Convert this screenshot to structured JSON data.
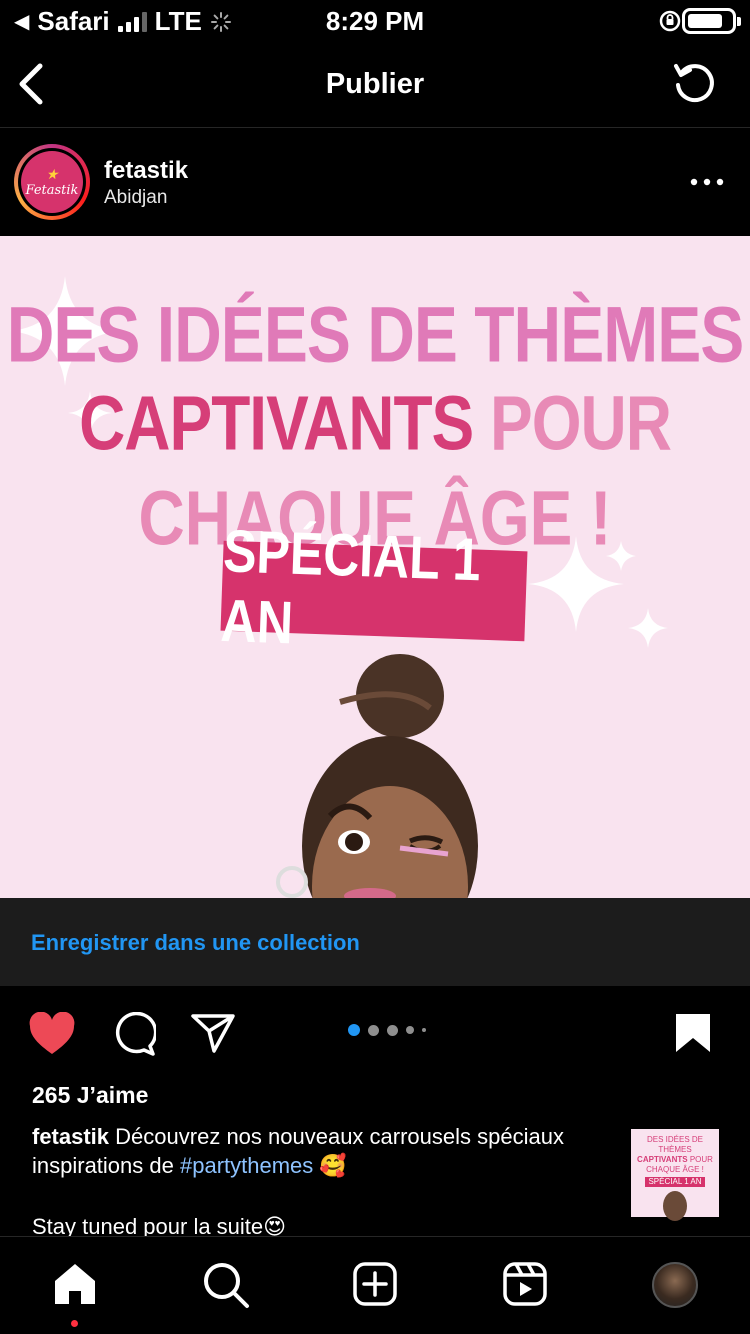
{
  "status_bar": {
    "back_app": "Safari",
    "carrier": "LTE",
    "time": "8:29 PM"
  },
  "nav": {
    "title": "Publier"
  },
  "post": {
    "username": "fetastik",
    "location": "Abidjan",
    "logo_text": "Fetastik",
    "image": {
      "line1": "DES IDÉES DE THÈMES",
      "line2a": "CAPTIVANTS",
      "line2b": "POUR",
      "line3": "CHAQUE ÂGE !",
      "badge": "SPÉCIAL 1 AN"
    },
    "save_to_collection": "Enregistrer dans une collection",
    "carousel": {
      "count": 5,
      "active_index": 0
    },
    "likes": "265 J’aime",
    "caption_user": "fetastik",
    "caption_text": "Découvrez nos nouveaux carrousels spéciaux",
    "caption_line2": "inspirations de",
    "hashtag": "#partythemes",
    "caption_emoji1": "🥰",
    "caption_line3": "Stay tuned pour la suite",
    "caption_emoji2": "😍",
    "thumbnail": {
      "line1": "DES IDÉES DE THÈMES",
      "line2a": "CAPTIVANTS",
      "line2b": "POUR",
      "line3": "CHAQUE ÂGE !",
      "badge": "SPÉCIAL 1 AN"
    }
  },
  "colors": {
    "accent_blue": "#2196f3",
    "like_red": "#ed4956",
    "brand_pink": "#d6336c",
    "image_bg": "#f9e3ef"
  },
  "tabbar": {
    "items": [
      "home-icon",
      "search-icon",
      "create-icon",
      "reels-icon",
      "profile-avatar"
    ]
  }
}
